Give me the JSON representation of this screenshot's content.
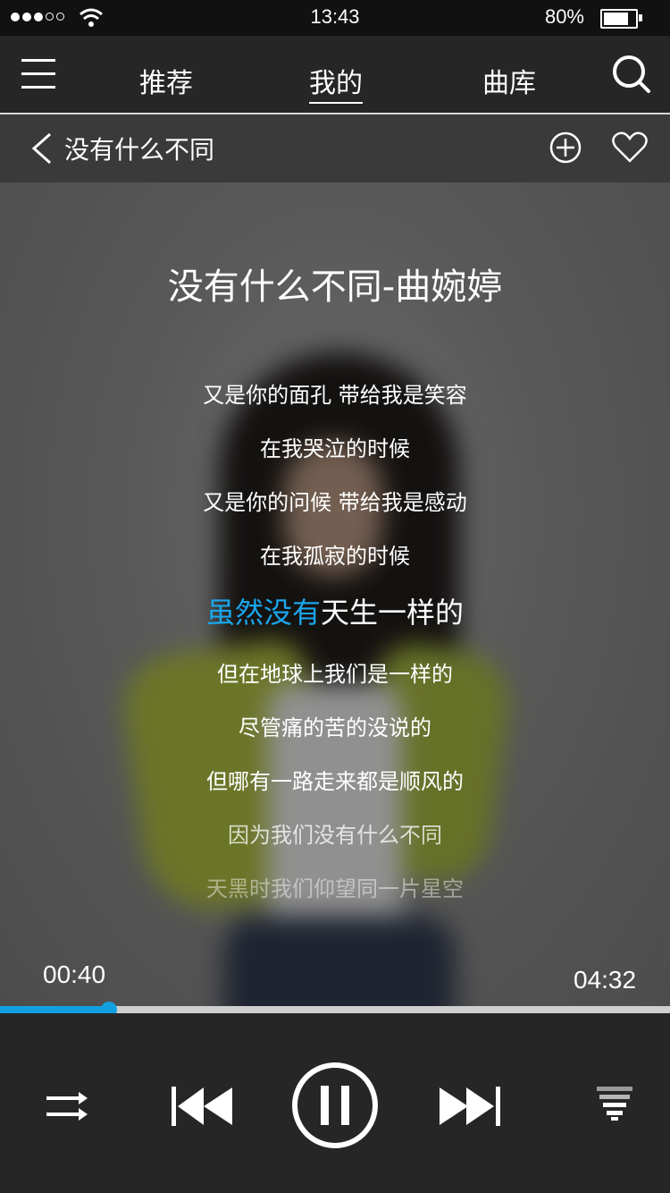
{
  "status_bar": {
    "time": "13:43",
    "battery_percent": "80%",
    "battery_level": 0.8
  },
  "nav": {
    "tabs": [
      "推荐",
      "我的",
      "曲库"
    ],
    "active_tab": "我的"
  },
  "sub_header": {
    "title": "没有什么不同"
  },
  "song": {
    "title": "没有什么不同-曲婉婷"
  },
  "lyrics": [
    "又是你的面孔 带给我是笑容",
    "在我哭泣的时候",
    "又是你的问候 带给我是感动",
    "在我孤寂的时候",
    "虽然没有天生一样的",
    "但在地球上我们是一样的",
    "尽管痛的苦的没说的",
    "但哪有一路走来都是顺风的",
    "因为我们没有什么不同",
    "天黑时我们仰望同一片星空"
  ],
  "current_line": {
    "sung": "虽然没有",
    "unsung": "天生一样的"
  },
  "playback": {
    "elapsed": "00:40",
    "duration": "04:32",
    "progress": 0.162
  },
  "colors": {
    "accent": "#12a0e0",
    "bar": "#262626",
    "subheader": "#3a3a3a"
  },
  "icons": [
    "menu-icon",
    "search-icon",
    "back-arrow-icon",
    "add-circle-icon",
    "heart-icon",
    "shuffle-icon",
    "previous-icon",
    "pause-icon",
    "next-icon",
    "equalizer-icon"
  ]
}
